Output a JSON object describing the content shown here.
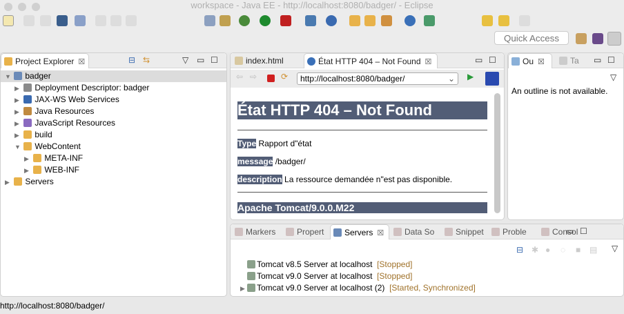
{
  "window": {
    "title": "workspace - Java EE - http://localhost:8080/badger/ - Eclipse"
  },
  "toolbar": {
    "quick_access_placeholder": "Quick Access"
  },
  "project_explorer": {
    "title": "Project Explorer",
    "tree": [
      {
        "label": "badger",
        "level": 0,
        "expanded": true,
        "icon": "project-icon"
      },
      {
        "label": "Deployment Descriptor: badger",
        "level": 1,
        "icon": "descriptor-icon"
      },
      {
        "label": "JAX-WS Web Services",
        "level": 1,
        "icon": "webservice-icon"
      },
      {
        "label": "Java Resources",
        "level": 1,
        "icon": "java-resources-icon"
      },
      {
        "label": "JavaScript Resources",
        "level": 1,
        "icon": "js-resources-icon"
      },
      {
        "label": "build",
        "level": 1,
        "icon": "folder-icon"
      },
      {
        "label": "WebContent",
        "level": 1,
        "expanded": true,
        "icon": "folder-icon"
      },
      {
        "label": "META-INF",
        "level": 2,
        "icon": "folder-icon"
      },
      {
        "label": "WEB-INF",
        "level": 2,
        "icon": "folder-icon"
      },
      {
        "label": "Servers",
        "level": 0,
        "icon": "folder-icon"
      }
    ]
  },
  "editor": {
    "tabs": [
      {
        "label": "index.html"
      },
      {
        "label": "État HTTP 404 – Not Found",
        "active": true
      }
    ],
    "url": "http://localhost:8080/badger/",
    "page": {
      "heading": "État HTTP 404 – Not Found",
      "type_label": "Type",
      "type_value": "Rapport d\"état",
      "message_label": "message",
      "message_value": "/badger/",
      "description_label": "description",
      "description_value": "La ressource demandée n\"est pas disponible.",
      "footer": "Apache Tomcat/9.0.0.M22"
    }
  },
  "outline": {
    "tabs": [
      {
        "label": "Ou"
      },
      {
        "label": "Ta"
      }
    ],
    "message": "An outline is not available."
  },
  "bottom": {
    "tabs": [
      {
        "label": "Markers"
      },
      {
        "label": "Propert"
      },
      {
        "label": "Servers",
        "active": true
      },
      {
        "label": "Data So"
      },
      {
        "label": "Snippet"
      },
      {
        "label": "Proble"
      },
      {
        "label": "Consol"
      }
    ],
    "servers": [
      {
        "name": "Tomcat v8.5 Server at localhost",
        "status": "[Stopped]"
      },
      {
        "name": "Tomcat v9.0 Server at localhost",
        "status": "[Stopped]"
      },
      {
        "name": "Tomcat v9.0 Server at localhost (2)",
        "status": "[Started, Synchronized]"
      }
    ]
  },
  "statusbar": {
    "text": "http://localhost:8080/badger/"
  },
  "colors": {
    "tomcat_heading": "#525d76",
    "status_text": "#a0722a",
    "selection": "#dcdcdc"
  }
}
